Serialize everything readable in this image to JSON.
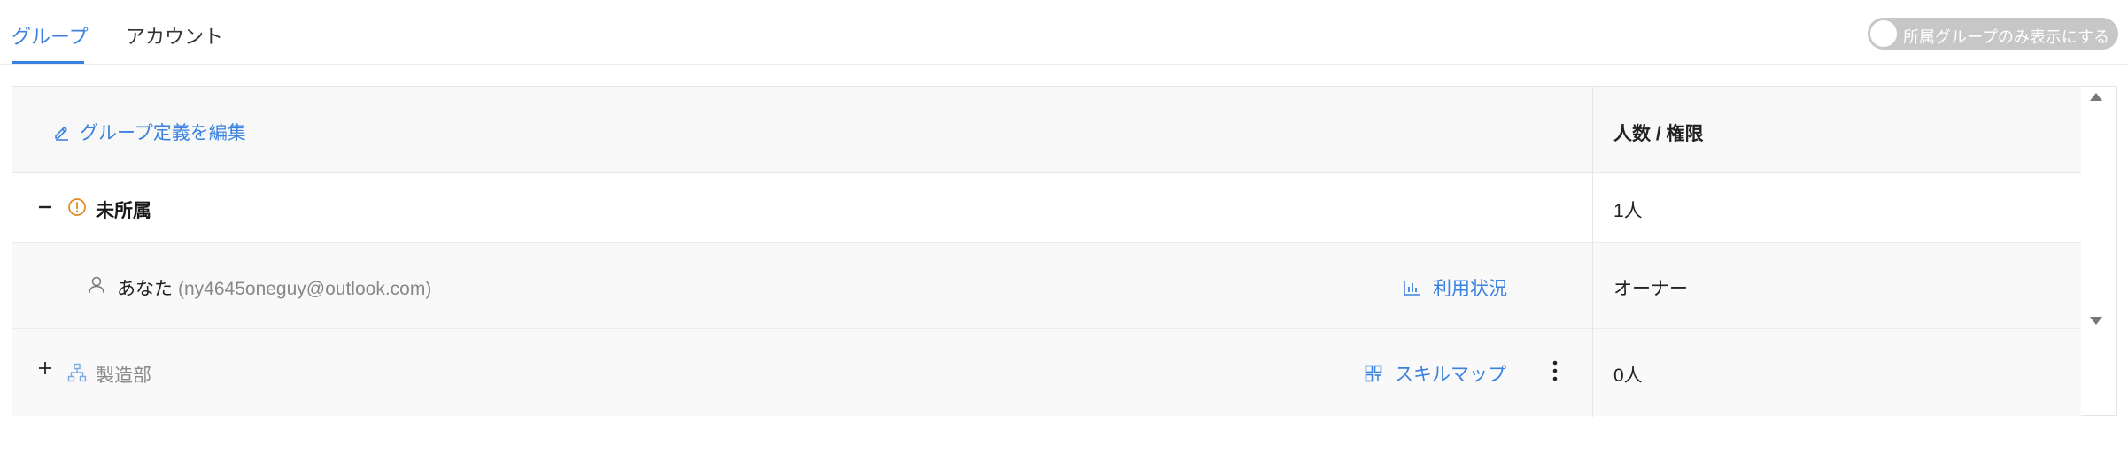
{
  "tabs": [
    {
      "label": "グループ",
      "active": true
    },
    {
      "label": "アカウント",
      "active": false
    }
  ],
  "toggle": {
    "label": "所属グループのみ表示にする",
    "on": false
  },
  "header": {
    "edit_label": "グループ定義を編集",
    "right_label": "人数 / 権限"
  },
  "rows": {
    "unassigned": {
      "name": "未所属",
      "count": "1人"
    },
    "you": {
      "name": "あなた",
      "email": "(ny4645oneguy@outlook.com)",
      "action_label": "利用状況",
      "role": "オーナー"
    },
    "manufacturing": {
      "name": "製造部",
      "action_label": "スキルマップ",
      "count": "0人"
    }
  },
  "icons": {
    "edit": "pencil-icon",
    "warning": "warning-circle-icon",
    "user": "user-icon",
    "usage": "bar-chart-icon",
    "org": "org-chart-icon",
    "skill": "grid-icon",
    "more": "more-vertical-icon"
  },
  "colors": {
    "accent": "#3b82e0",
    "warning": "#e08a1e",
    "toggle_off": "#c7c7c7"
  }
}
